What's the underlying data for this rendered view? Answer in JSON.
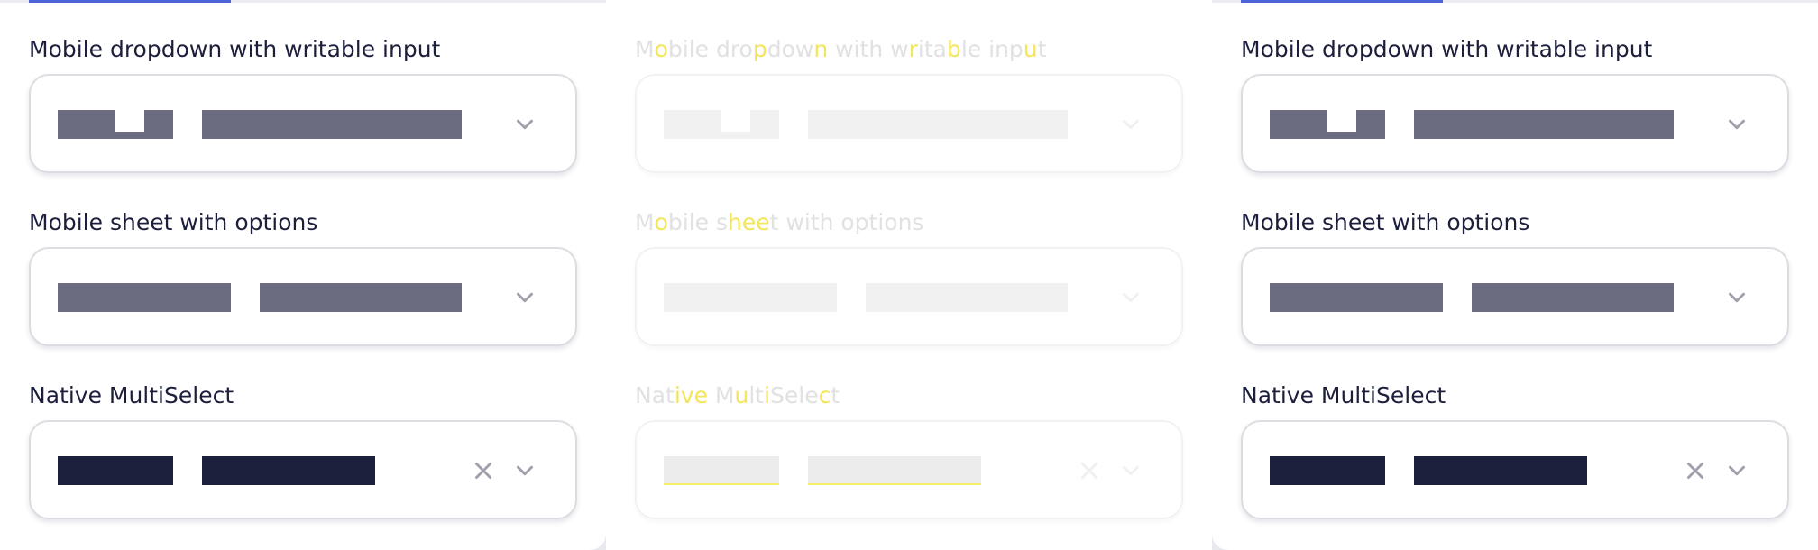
{
  "fields": {
    "writable": {
      "label": "Mobile dropdown with writable input"
    },
    "sheet": {
      "label": "Mobile sheet with options"
    },
    "multiselect": {
      "label": "Native MultiSelect"
    }
  },
  "middle_highlight": {
    "writable": [
      {
        "t": "M",
        "h": false
      },
      {
        "t": "o",
        "h": true
      },
      {
        "t": "bile dro",
        "h": false
      },
      {
        "t": "p",
        "h": true
      },
      {
        "t": "dow",
        "h": false
      },
      {
        "t": "n",
        "h": true
      },
      {
        "t": " with w",
        "h": false
      },
      {
        "t": "r",
        "h": true
      },
      {
        "t": "ita",
        "h": false
      },
      {
        "t": "b",
        "h": true
      },
      {
        "t": "le inp",
        "h": false
      },
      {
        "t": "u",
        "h": true
      },
      {
        "t": "t",
        "h": false
      }
    ],
    "sheet": [
      {
        "t": "M",
        "h": false
      },
      {
        "t": "o",
        "h": true
      },
      {
        "t": "bile s",
        "h": false
      },
      {
        "t": "hee",
        "h": true
      },
      {
        "t": "t",
        "h": false
      },
      {
        "t": " with options",
        "h": false
      }
    ],
    "multiselect": [
      {
        "t": "Nat",
        "h": false
      },
      {
        "t": "ive",
        "h": true
      },
      {
        "t": " M",
        "h": false
      },
      {
        "t": "u",
        "h": true
      },
      {
        "t": "lt",
        "h": false
      },
      {
        "t": "i",
        "h": true
      },
      {
        "t": "Sele",
        "h": false
      },
      {
        "t": "c",
        "h": true
      },
      {
        "t": "t",
        "h": false
      }
    ]
  },
  "icons": {
    "chevron": "chevron-down-icon",
    "clear": "close-icon"
  },
  "colors": {
    "accent": "#4f63d9",
    "tag_gray": "#6b6c80",
    "tag_dark": "#1c1f3b",
    "label": "#1b1f3b",
    "icon": "#a0a1ad"
  }
}
